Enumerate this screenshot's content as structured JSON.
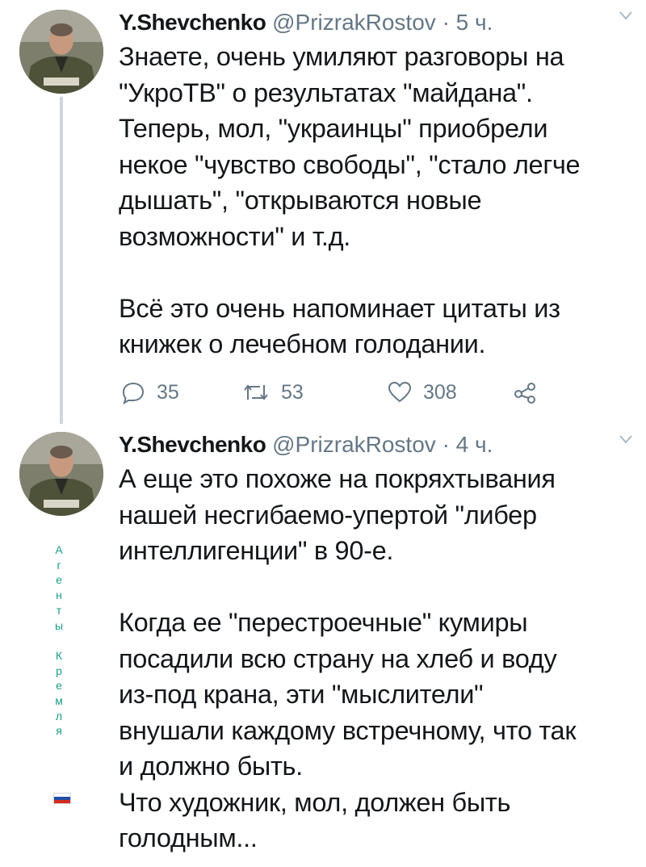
{
  "tweets": [
    {
      "author_name": "Y.Shevchenko",
      "handle": "@PrizrakRostov",
      "time": "· 5 ч.",
      "text": "Знаете, очень умиляют разговоры на\n\"УкроТВ\" о результатах \"майдана\".\nТеперь, мол, \"украинцы\" приобрели\nнекое \"чувство свободы\", \"стало легче\nдышать\", \"открываются новые\nвозможности\" и т.д.\n\nВсё это очень напоминает цитаты из\nкнижек о лечебном голодании.",
      "replies": "35",
      "retweets": "53",
      "likes": "308"
    },
    {
      "author_name": "Y.Shevchenko",
      "handle": "@PrizrakRostov",
      "time": "· 4 ч.",
      "text": "А еще это похоже на покряхтывания\nнашей несгибаемо-упертой \"либер\nинтеллигенции\" в 90-е.\n\nКогда ее \"перестроечные\" кумиры\nпосадили всю страну на хлеб и воду\nиз-под крана, эти \"мыслители\"\nвнушали каждому встречному, что так\nи должно быть.\nЧто художник, мол, должен быть\nголодным..."
    }
  ],
  "watermark": {
    "text": "А\nг\nе\nн\nт\nы\n\nК\nр\nе\nм\nл\nя",
    "color": "#1a9c8a"
  },
  "icons": {
    "reply": "reply-icon",
    "retweet": "retweet-icon",
    "like": "heart-icon",
    "share": "share-icon",
    "menu": "chevron-down-icon",
    "flag": "russian-flag-icon"
  },
  "colors": {
    "text": "#14171a",
    "secondary": "#657786",
    "thread_line": "#ccd6dd",
    "flag": [
      "#ffffff",
      "#1f4ea8",
      "#d52b1e"
    ]
  }
}
